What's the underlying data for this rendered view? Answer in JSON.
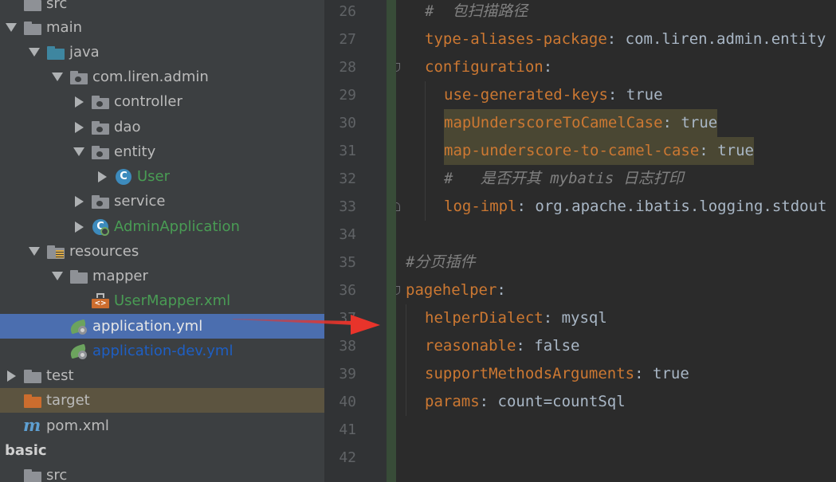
{
  "project_tree": {
    "items": [
      {
        "label": "src",
        "arrow": "none",
        "icon": "folder",
        "color": "default",
        "depth": 0,
        "state": ""
      },
      {
        "label": "main",
        "arrow": "down",
        "icon": "folder",
        "color": "default",
        "depth": 0,
        "state": ""
      },
      {
        "label": "java",
        "arrow": "down",
        "icon": "folder-blue",
        "color": "default",
        "depth": 1,
        "state": ""
      },
      {
        "label": "com.liren.admin",
        "arrow": "down",
        "icon": "package",
        "color": "default",
        "depth": 2,
        "state": ""
      },
      {
        "label": "controller",
        "arrow": "right",
        "icon": "package",
        "color": "default",
        "depth": 3,
        "state": ""
      },
      {
        "label": "dao",
        "arrow": "right",
        "icon": "package",
        "color": "default",
        "depth": 3,
        "state": ""
      },
      {
        "label": "entity",
        "arrow": "down",
        "icon": "package",
        "color": "default",
        "depth": 3,
        "state": ""
      },
      {
        "label": "User",
        "arrow": "right",
        "icon": "class",
        "color": "green",
        "depth": 4,
        "state": ""
      },
      {
        "label": "service",
        "arrow": "right",
        "icon": "package",
        "color": "default",
        "depth": 3,
        "state": ""
      },
      {
        "label": "AdminApplication",
        "arrow": "right",
        "icon": "class-run",
        "color": "green",
        "depth": 3,
        "state": ""
      },
      {
        "label": "resources",
        "arrow": "down",
        "icon": "resources",
        "color": "default",
        "depth": 1,
        "state": ""
      },
      {
        "label": "mapper",
        "arrow": "down",
        "icon": "folder",
        "color": "default",
        "depth": 2,
        "state": ""
      },
      {
        "label": "UserMapper.xml",
        "arrow": "none",
        "icon": "xml",
        "color": "green",
        "depth": 3,
        "state": ""
      },
      {
        "label": "application.yml",
        "arrow": "none",
        "icon": "spring",
        "color": "selected",
        "depth": 2,
        "state": "selected"
      },
      {
        "label": "application-dev.yml",
        "arrow": "none",
        "icon": "spring",
        "color": "blue",
        "depth": 2,
        "state": ""
      },
      {
        "label": "test",
        "arrow": "right",
        "icon": "folder",
        "color": "default",
        "depth": 0,
        "state": ""
      },
      {
        "label": "target",
        "arrow": "none",
        "icon": "folder-orange",
        "color": "default",
        "depth": 0,
        "state": "highlight"
      },
      {
        "label": "pom.xml",
        "arrow": "none",
        "icon": "maven",
        "color": "default",
        "depth": 0,
        "state": ""
      },
      {
        "label": "basic",
        "arrow": "none",
        "icon": "none",
        "color": "bold",
        "depth": 0,
        "state": ""
      },
      {
        "label": "src",
        "arrow": "none",
        "icon": "folder",
        "color": "default",
        "depth": 0,
        "state": ""
      }
    ]
  },
  "editor": {
    "lines": [
      {
        "num": "26",
        "indent": 1,
        "key": "",
        "sep": "",
        "value": "",
        "comment": "#  包扫描路径",
        "highlight": false,
        "fold": ""
      },
      {
        "num": "27",
        "indent": 1,
        "key": "type-aliases-package",
        "sep": ": ",
        "value": "com.liren.admin.entity",
        "comment": "",
        "highlight": false,
        "fold": ""
      },
      {
        "num": "28",
        "indent": 1,
        "key": "configuration",
        "sep": ":",
        "value": "",
        "comment": "",
        "highlight": false,
        "fold": "top"
      },
      {
        "num": "29",
        "indent": 2,
        "key": "use-generated-keys",
        "sep": ": ",
        "value": "true",
        "comment": "",
        "highlight": false,
        "fold": ""
      },
      {
        "num": "30",
        "indent": 2,
        "key": "mapUnderscoreToCamelCase",
        "sep": ": ",
        "value": "true",
        "comment": "",
        "highlight": true,
        "fold": ""
      },
      {
        "num": "31",
        "indent": 2,
        "key": "map-underscore-to-camel-case",
        "sep": ": ",
        "value": "true",
        "comment": "",
        "highlight": true,
        "fold": ""
      },
      {
        "num": "32",
        "indent": 2,
        "key": "",
        "sep": "",
        "value": "",
        "comment": "#   是否开其 mybatis 日志打印",
        "highlight": false,
        "fold": ""
      },
      {
        "num": "33",
        "indent": 2,
        "key": "log-impl",
        "sep": ": ",
        "value": "org.apache.ibatis.logging.stdout",
        "comment": "",
        "highlight": false,
        "fold": "end"
      },
      {
        "num": "34",
        "indent": 0,
        "key": "",
        "sep": "",
        "value": "",
        "comment": "",
        "highlight": false,
        "fold": ""
      },
      {
        "num": "35",
        "indent": 0,
        "key": "",
        "sep": "",
        "value": "",
        "comment": "#分页插件",
        "highlight": false,
        "fold": ""
      },
      {
        "num": "36",
        "indent": 0,
        "key": "pagehelper",
        "sep": ":",
        "value": "",
        "comment": "",
        "highlight": false,
        "fold": "top"
      },
      {
        "num": "37",
        "indent": 1,
        "key": "helperDialect",
        "sep": ": ",
        "value": "mysql",
        "comment": "",
        "highlight": false,
        "fold": ""
      },
      {
        "num": "38",
        "indent": 1,
        "key": "reasonable",
        "sep": ": ",
        "value": "false",
        "comment": "",
        "highlight": false,
        "fold": ""
      },
      {
        "num": "39",
        "indent": 1,
        "key": "supportMethodsArguments",
        "sep": ": ",
        "value": "true",
        "comment": "",
        "highlight": false,
        "fold": ""
      },
      {
        "num": "40",
        "indent": 1,
        "key": "params",
        "sep": ": ",
        "value": "count=countSql",
        "comment": "",
        "highlight": false,
        "fold": ""
      },
      {
        "num": "41",
        "indent": 0,
        "key": "",
        "sep": "",
        "value": "",
        "comment": "",
        "highlight": false,
        "fold": ""
      },
      {
        "num": "42",
        "indent": 0,
        "key": "",
        "sep": "",
        "value": "",
        "comment": "",
        "highlight": false,
        "fold": ""
      }
    ]
  },
  "colors": {
    "tree_background": "#3c3f41",
    "selected_row": "#4b6eaf",
    "editor_background": "#2b2b2b",
    "yaml_key": "#cc7832",
    "yaml_value": "#a9b7c6",
    "comment": "#808080",
    "annotation_arrow": "#e8342b"
  }
}
